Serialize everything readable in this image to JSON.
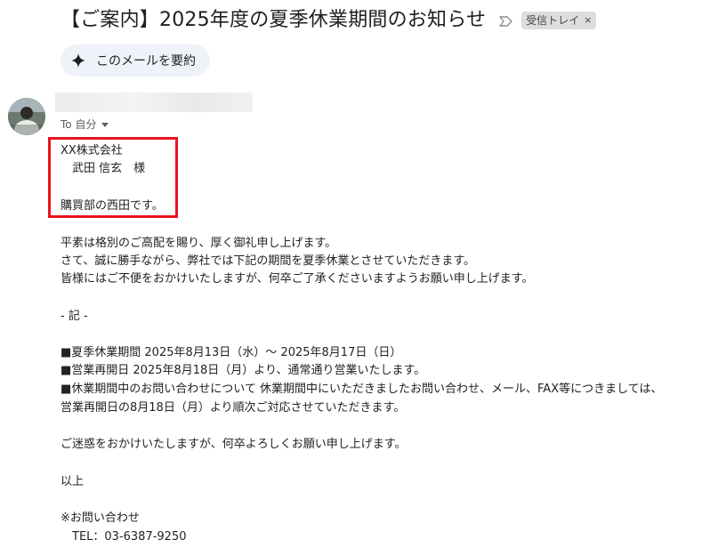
{
  "email": {
    "subject": "【ご案内】2025年度の夏季休業期間のお知らせ",
    "label_chip": "受信トレイ",
    "label_chip_close": "×",
    "summarize_label": "このメールを要約",
    "recipient_label": "To 自分",
    "body_lines": {
      "company": "XX株式会社",
      "addressee": "　武田 信玄　様",
      "intro": "購買部の西田です。",
      "greeting_1": "平素は格別のご高配を賜り、厚く御礼申し上げます。",
      "greeting_2": "さて、誠に勝手ながら、弊社では下記の期間を夏季休業とさせていただきます。",
      "greeting_3": "皆様にはご不便をおかけいたしますが、何卒ご了承くださいますようお願い申し上げます。",
      "ki": " - 記 -",
      "item_1": "■夏季休業期間 2025年8月13日（水）～ 2025年8月17日（日）",
      "item_2": "■営業再開日 2025年8月18日（月）より、通常通り営業いたします。",
      "item_3a": "■休業期間中のお問い合わせについて 休業期間中にいただきましたお問い合わせ、メール、FAX等につきましては、",
      "item_3b": " 営業再開日の8月18日（月）より順次ご対応させていただきます。",
      "closing": "ご迷惑をおかけいたしますが、何卒よろしくお願い申し上げます。",
      "ijou": "以上",
      "contact_heading": "※お問い合わせ",
      "contact_tel": "　TEL：03-6387-9250"
    }
  },
  "icons": {
    "important_marker": "importance-marker-icon",
    "summarize": "sparkle-icon",
    "avatar": "sender-avatar"
  },
  "colors": {
    "highlight": "#e8141e",
    "summarize_bg": "#eef2f9",
    "chip_bg": "#dddddd"
  }
}
